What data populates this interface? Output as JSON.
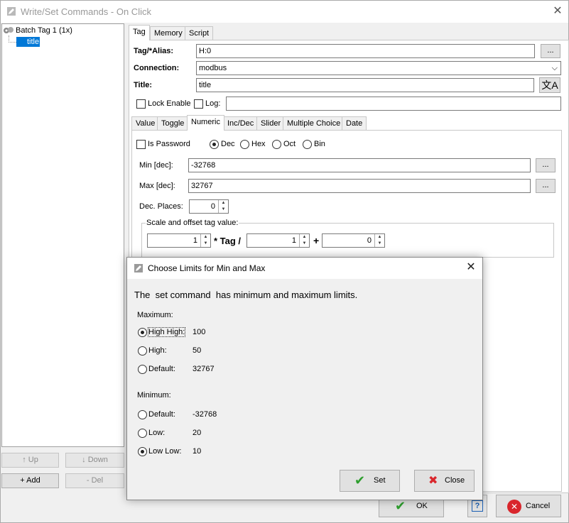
{
  "window": {
    "title": "Write/Set Commands - On Click"
  },
  "tree": {
    "root": "Batch Tag 1 (1x)",
    "child": "title"
  },
  "left_buttons": {
    "up": "↑ Up",
    "down": "↓ Down",
    "add": "+ Add",
    "del": "- Del"
  },
  "top_tabs": [
    "Tag",
    "Memory",
    "Script"
  ],
  "form": {
    "tag_label": "Tag/*Alias:",
    "tag_value": "H:0",
    "browse": "...",
    "connection_label": "Connection:",
    "connection_value": "modbus",
    "title_label": "Title:",
    "title_value": "title",
    "lock_enable": "Lock Enable",
    "log": "Log:"
  },
  "sub_tabs": [
    "Value",
    "Toggle",
    "Numeric",
    "Inc/Dec",
    "Slider",
    "Multiple Choice",
    "Date"
  ],
  "numeric": {
    "is_password": "Is Password",
    "dec": "Dec",
    "hex": "Hex",
    "oct": "Oct",
    "bin": "Bin",
    "min_label": "Min [dec]:",
    "min_value": "-32768",
    "max_label": "Max [dec]:",
    "max_value": "32767",
    "dec_places_label": "Dec. Places:",
    "dec_places_value": "0",
    "scale_group": "Scale and offset tag value:",
    "scale_value": "1",
    "times_tag": "* Tag /",
    "divisor_value": "1",
    "plus": "+",
    "offset_value": "0"
  },
  "bottom": {
    "ok": "OK",
    "help": "?",
    "cancel": "Cancel"
  },
  "dialog": {
    "title": "Choose Limits for Min and Max",
    "message": "The  set command  has minimum and maximum limits.",
    "maximum_label": "Maximum:",
    "max_options": [
      {
        "label": "High High:",
        "value": "100",
        "selected": true
      },
      {
        "label": "High:",
        "value": "50",
        "selected": false
      },
      {
        "label": "Default:",
        "value": "32767",
        "selected": false
      }
    ],
    "minimum_label": "Minimum:",
    "min_options": [
      {
        "label": "Default:",
        "value": "-32768",
        "selected": false
      },
      {
        "label": "Low:",
        "value": "20",
        "selected": false
      },
      {
        "label": "Low Low:",
        "value": "10",
        "selected": true
      }
    ],
    "set": "Set",
    "close": "Close"
  },
  "colors": {
    "selection": "#0078d7",
    "check_green": "#2e9e2e",
    "close_red": "#d9262c"
  }
}
